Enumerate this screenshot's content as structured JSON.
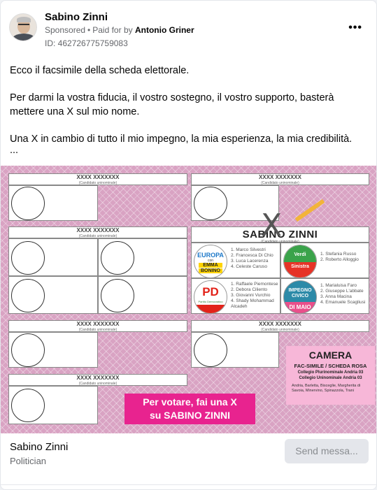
{
  "post": {
    "author": "Sabino Zinni",
    "sponsored": "Sponsored",
    "paid_for_prefix": "Paid for by",
    "paid_by": "Antonio Griner",
    "ad_id": "ID: 462726775759083",
    "more_icon": "•••",
    "paragraphs": [
      "Ecco il facsimile della scheda elettorale.",
      "Per darmi la vostra fiducia, il vostro sostegno, il vostro supporto, basterà mettere una X sul mio nome.",
      "Una X in cambio di tutto il mio impegno, la mia esperienza, la mia credibilità."
    ],
    "ellipsis": "..."
  },
  "ballot": {
    "placeholder_name": "XXXX XXXXXXX",
    "placeholder_sub": "(Candidato uninominale)",
    "candidate": "SABINO ZINNI",
    "candidate_sub": "(Candidato uninominale)",
    "mark": "X",
    "parties": [
      {
        "logo": [
          "EUROPA",
          "con",
          "EMMA",
          "BONINO"
        ],
        "names": [
          "1. Marco Silvestri",
          "2. Francesca Di Chio",
          "3. Luca Lacerenza",
          "4. Celeste Caruso"
        ]
      },
      {
        "logo": [
          "Verdi",
          "Sinistra"
        ],
        "names": [
          "1. Stefania Russo",
          "2. Roberto Alloggio"
        ]
      },
      {
        "logo": [
          "PD",
          "Partito Democratico"
        ],
        "names": [
          "1. Raffaele Piemontese",
          "2. Debora Ciliento",
          "3. Giovanni Vurchio",
          "4. Shady Mohammad",
          "Alcadeh"
        ]
      },
      {
        "logo": [
          "IMPEGNO",
          "CIVICO",
          "DI MAIO"
        ],
        "names": [
          "1. Marialuisa Faro",
          "2. Giuseppe L'abbate",
          "3. Anna Macina",
          "4. Emanuele Scagliusi"
        ]
      }
    ],
    "camera": {
      "title": "CAMERA",
      "subtitle": "FAC-SIMILE / SCHEDA ROSA",
      "college1": "Collegio Plurinominale Andria 03",
      "college2": "Collegio Uninominale Andria 03",
      "towns": "Andria, Barletta, Bisceglie, Margherita di Savoia, Minervino, Spinazzola, Trani"
    },
    "cta_line1": "Per votare, fai una X",
    "cta_line2": "su SABINO ZINNI"
  },
  "footer": {
    "name": "Sabino Zinni",
    "role": "Politician",
    "button": "Send messa..."
  }
}
